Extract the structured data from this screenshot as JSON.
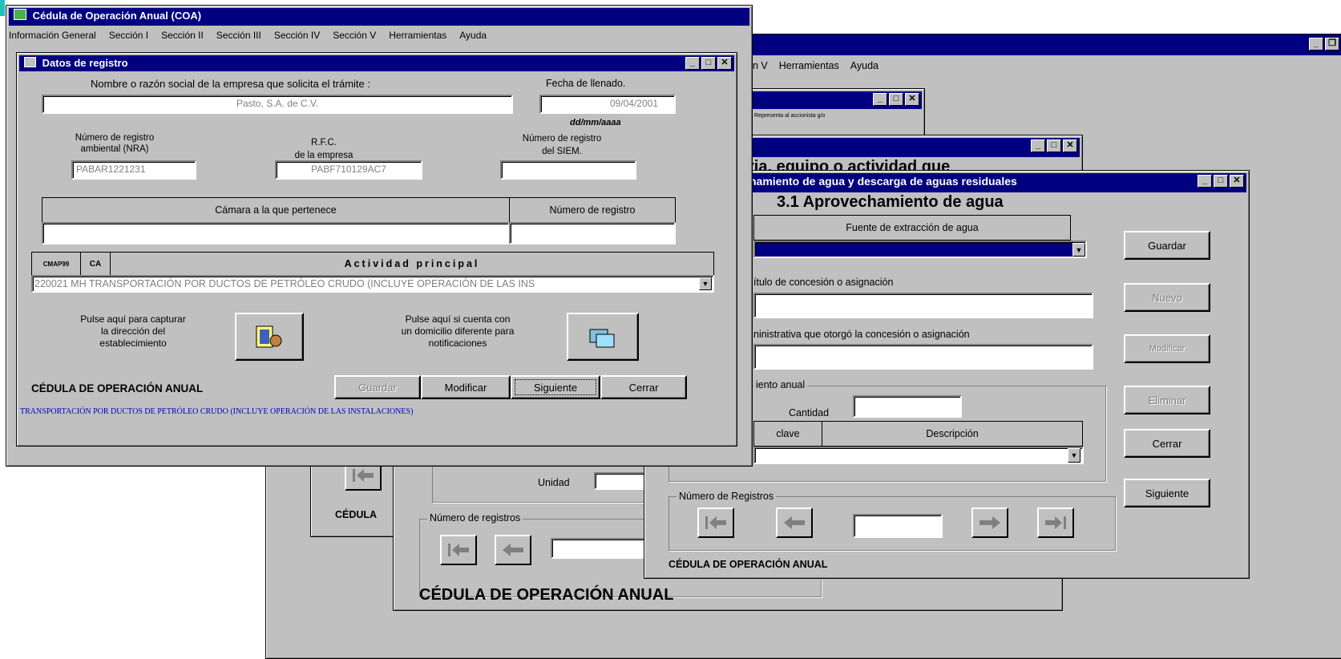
{
  "colors": {
    "titlebar": "#000080",
    "face": "#c0c0c0",
    "link_text": "#0000c0"
  },
  "app_window": {
    "menu": [
      "on V",
      "Herramientas",
      "Ayuda"
    ],
    "footer": "CÉDULA DE OPERACIÓN ANUAL"
  },
  "back_dialog_1": {
    "tiny_text": "Representa al accionista g/o"
  },
  "back_dialog_2": {
    "title_fragment": "ria, equipo o actividad que",
    "unidad_label": "Unidad",
    "registros_group": "Número de registros",
    "footer": "CÉDULA DE OPERACIÓN ANUAL",
    "footer_left": "CÉDULA"
  },
  "water_dialog": {
    "title": "hamiento de agua y descarga de aguas residuales",
    "heading": "3.1 Aprovechamiento de agua",
    "fuente_header": "Fuente de extracción de agua",
    "titulo_label": "ítulo de concesión o asignación",
    "autoridad_label": "ninistrativa que otorgó la concesión o asignación",
    "volumen_group": "iento anual",
    "cantidad_label": "Cantidad",
    "clave_header": "clave",
    "descripcion_header": "Descripción",
    "registros_group": "Número de Registros",
    "footer": "CÉDULA DE OPERACIÓN ANUAL",
    "buttons": {
      "guardar": "Guardar",
      "nuevo": "Nuevo",
      "modificar": "Modificar",
      "eliminar": "Eliminar",
      "cerrar": "Cerrar",
      "siguiente": "Siguiente"
    }
  },
  "main_window": {
    "title": "Cédula de Operación Anual (COA)",
    "menu": [
      "Información General",
      "Sección I",
      "Sección II",
      "Sección III",
      "Sección IV",
      "Sección V",
      "Herramientas",
      "Ayuda"
    ]
  },
  "registro_dialog": {
    "title": "Datos de registro",
    "empresa_label": "Nombre o razón social de la empresa que solicita el trámite :",
    "empresa_value": "Pasto, S.A. de C.V.",
    "fecha_label": "Fecha de llenado.",
    "fecha_value": "09/04/2001",
    "fecha_format": "dd/mm/aaaa",
    "nra_label_1": "Número de registro",
    "nra_label_2": "ambiental (NRA)",
    "nra_value": "PABAR1221231",
    "rfc_label_1": "R.F.C.",
    "rfc_label_2": "de la empresa",
    "rfc_value": "PABF710129AC7",
    "siem_label_1": "Número de registro",
    "siem_label_2": "del SIEM.",
    "siem_value": "",
    "camara_header": "Cámara a la que pertenece",
    "camara_registro_header": "Número de registro",
    "cmap_header": "CMAP99",
    "ca_header": "CA",
    "actividad_header": "Actividad principal",
    "actividad_value": "220021  MH  TRANSPORTACIÓN POR DUCTOS DE PETRÓLEO CRUDO (INCLUYE OPERACIÓN DE LAS INS",
    "direccion_text": [
      "Pulse aquí para capturar",
      "la dirección del",
      "establecimiento"
    ],
    "notif_text": [
      "Pulse aquí si cuenta con",
      "un domicilio diferente para",
      "notificaciones"
    ],
    "footer": "CÉDULA DE OPERACIÓN ANUAL",
    "buttons": {
      "guardar": "Guardar",
      "modificar": "Modificar",
      "siguiente": "Siguiente",
      "cerrar": "Cerrar"
    },
    "status_text": "TRANSPORTACIÓN POR DUCTOS DE PETRÓLEO CRUDO (INCLUYE OPERACIÓN DE LAS INSTALACIONES)"
  }
}
